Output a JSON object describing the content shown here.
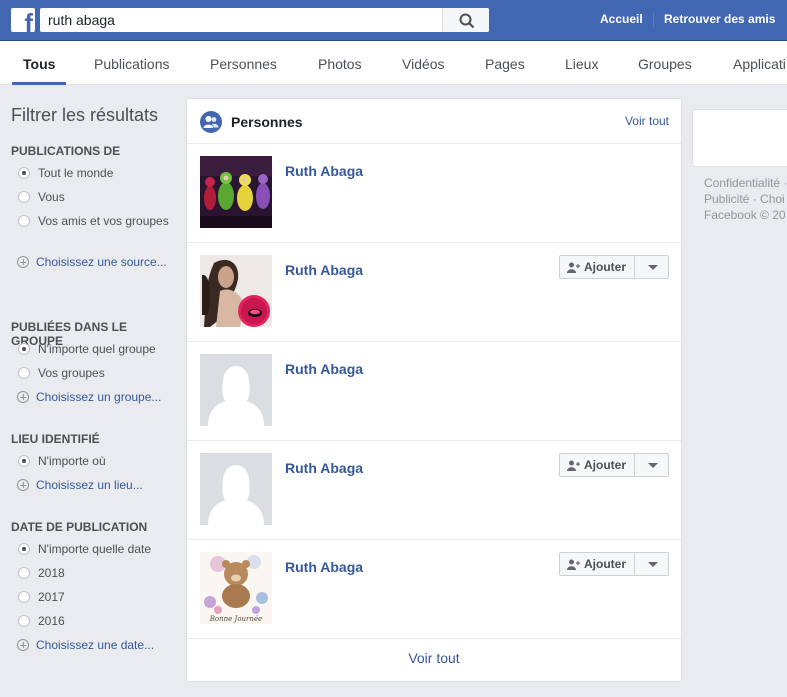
{
  "topbar": {
    "logo_letter": "f",
    "search_value": "ruth abaga",
    "nav": {
      "home": "Accueil",
      "find_friends": "Retrouver des amis"
    }
  },
  "tabs": [
    {
      "label": "Tous"
    },
    {
      "label": "Publications"
    },
    {
      "label": "Personnes"
    },
    {
      "label": "Photos"
    },
    {
      "label": "Vidéos"
    },
    {
      "label": "Pages"
    },
    {
      "label": "Lieux"
    },
    {
      "label": "Groupes"
    },
    {
      "label": "Applicati"
    }
  ],
  "sidebar": {
    "title": "Filtrer les résultats",
    "sections": [
      {
        "title": "PUBLICATIONS DE",
        "options": [
          "Tout le monde",
          "Vous",
          "Vos amis et vos groupes"
        ],
        "choose": "Choisissez une source..."
      },
      {
        "title": "PUBLIÉES DANS LE GROUPE",
        "options": [
          "N'importe quel groupe",
          "Vos groupes"
        ],
        "choose": "Choisissez un groupe..."
      },
      {
        "title": "LIEU IDENTIFIÉ",
        "options": [
          "N'importe où"
        ],
        "choose": "Choisissez un lieu..."
      },
      {
        "title": "DATE DE PUBLICATION",
        "options": [
          "N'importe quelle date",
          "2018",
          "2017",
          "2016"
        ],
        "choose": "Choisissez une date..."
      }
    ]
  },
  "people": {
    "title": "Personnes",
    "see_all_top": "Voir tout",
    "see_all_bottom": "Voir tout",
    "add_label": "Ajouter",
    "results": [
      {
        "name": "Ruth Abaga",
        "has_add": false,
        "avatar": "teletubbies-photo"
      },
      {
        "name": "Ruth Abaga",
        "has_add": true,
        "avatar": "woman-photo"
      },
      {
        "name": "Ruth Abaga",
        "has_add": false,
        "avatar": "default-silhouette"
      },
      {
        "name": "Ruth Abaga",
        "has_add": true,
        "avatar": "default-silhouette"
      },
      {
        "name": "Ruth Abaga",
        "has_add": true,
        "avatar": "teddy-bear-photo",
        "avatar_caption": "Bonne Journée"
      }
    ]
  },
  "right": {
    "links": [
      "Confidentialité ·",
      "Publicité · Choi",
      "Facebook © 20"
    ]
  },
  "colors": {
    "brand": "#4267b2",
    "link": "#365899",
    "background": "#e9ebee"
  }
}
